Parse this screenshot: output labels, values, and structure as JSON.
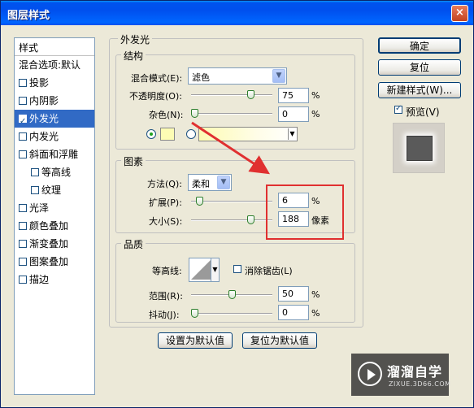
{
  "window": {
    "title": "图层样式",
    "close_glyph": "×"
  },
  "left_panel": {
    "header": "样式",
    "items": [
      {
        "label": "混合选项:默认",
        "checkbox": false,
        "checked": false,
        "indent": false,
        "selected": false
      },
      {
        "label": "投影",
        "checkbox": true,
        "checked": false,
        "indent": false,
        "selected": false
      },
      {
        "label": "内阴影",
        "checkbox": true,
        "checked": false,
        "indent": false,
        "selected": false
      },
      {
        "label": "外发光",
        "checkbox": true,
        "checked": true,
        "indent": false,
        "selected": true
      },
      {
        "label": "内发光",
        "checkbox": true,
        "checked": false,
        "indent": false,
        "selected": false
      },
      {
        "label": "斜面和浮雕",
        "checkbox": true,
        "checked": false,
        "indent": false,
        "selected": false
      },
      {
        "label": "等高线",
        "checkbox": true,
        "checked": false,
        "indent": true,
        "selected": false
      },
      {
        "label": "纹理",
        "checkbox": true,
        "checked": false,
        "indent": true,
        "selected": false
      },
      {
        "label": "光泽",
        "checkbox": true,
        "checked": false,
        "indent": false,
        "selected": false
      },
      {
        "label": "颜色叠加",
        "checkbox": true,
        "checked": false,
        "indent": false,
        "selected": false
      },
      {
        "label": "渐变叠加",
        "checkbox": true,
        "checked": false,
        "indent": false,
        "selected": false
      },
      {
        "label": "图案叠加",
        "checkbox": true,
        "checked": false,
        "indent": false,
        "selected": false
      },
      {
        "label": "描边",
        "checkbox": true,
        "checked": false,
        "indent": false,
        "selected": false
      }
    ]
  },
  "outer_glow": {
    "title": "外发光",
    "structure": {
      "title": "结构",
      "blend_mode_label": "混合模式(E):",
      "blend_mode_value": "滤色",
      "opacity_label": "不透明度(O):",
      "opacity_value": "75",
      "opacity_fraction": 0.75,
      "noise_label": "杂色(N):",
      "noise_value": "0",
      "noise_fraction": 0,
      "percent": "%",
      "glow_color": "#fdfcb4"
    },
    "elements": {
      "title": "图素",
      "technique_label": "方法(Q):",
      "technique_value": "柔和",
      "spread_label": "扩展(P):",
      "spread_value": "6",
      "spread_fraction": 0.06,
      "size_label": "大小(S):",
      "size_value": "188",
      "size_fraction": 0.754,
      "percent": "%",
      "px_unit": "像素"
    },
    "quality": {
      "title": "品质",
      "contour_label": "等高线:",
      "antialias_label": "消除锯齿(L)",
      "antialias_checked": false,
      "range_label": "范围(R):",
      "range_value": "50",
      "range_fraction": 0.5,
      "jitter_label": "抖动(J):",
      "jitter_value": "0",
      "jitter_fraction": 0,
      "percent": "%"
    },
    "set_default": "设置为默认值",
    "reset_default": "复位为默认值"
  },
  "buttons": {
    "ok": "确定",
    "reset": "复位",
    "new_style": "新建样式(W)...",
    "preview_label": "预览(V)",
    "preview_checked": true
  },
  "annotation": {
    "color": "#e03030"
  },
  "watermark": {
    "title": "溜溜自学",
    "subtitle": "ZIXUE.3D66.COM"
  }
}
